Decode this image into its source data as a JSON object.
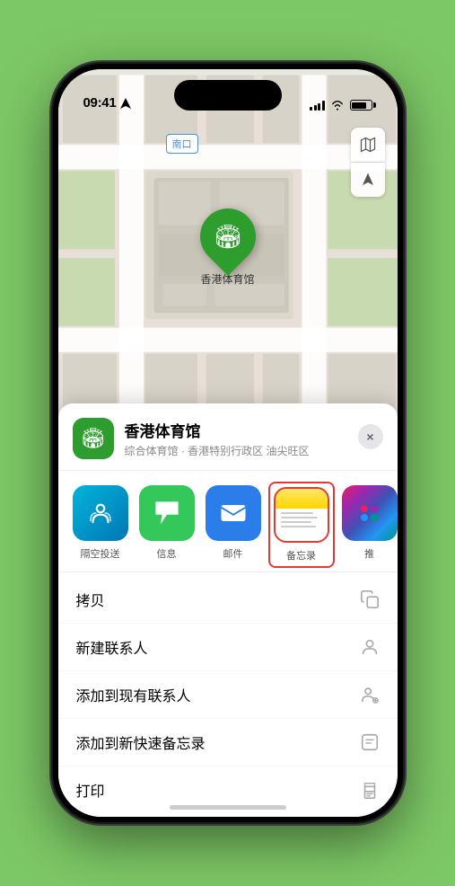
{
  "status_bar": {
    "time": "09:41",
    "location_arrow": "▲"
  },
  "map": {
    "nankou_label": "南口",
    "location_name": "香港体育馆",
    "map_icon": "🏟"
  },
  "map_controls": {
    "map_type_icon": "🗺",
    "location_icon": "⬆"
  },
  "venue_card": {
    "name": "香港体育馆",
    "description": "综合体育馆 · 香港特别行政区 油尖旺区",
    "close": "×"
  },
  "share_items": [
    {
      "id": "airdrop",
      "label": "隔空投送",
      "type": "airdrop"
    },
    {
      "id": "messages",
      "label": "信息",
      "type": "messages"
    },
    {
      "id": "mail",
      "label": "邮件",
      "type": "mail"
    },
    {
      "id": "notes",
      "label": "备忘录",
      "type": "notes"
    },
    {
      "id": "more",
      "label": "推",
      "type": "more"
    }
  ],
  "actions": [
    {
      "id": "copy",
      "label": "拷贝",
      "icon": "📋"
    },
    {
      "id": "new-contact",
      "label": "新建联系人",
      "icon": "👤"
    },
    {
      "id": "add-contact",
      "label": "添加到现有联系人",
      "icon": "👤+"
    },
    {
      "id": "quick-note",
      "label": "添加到新快速备忘录",
      "icon": "📝"
    },
    {
      "id": "print",
      "label": "打印",
      "icon": "🖨"
    }
  ]
}
